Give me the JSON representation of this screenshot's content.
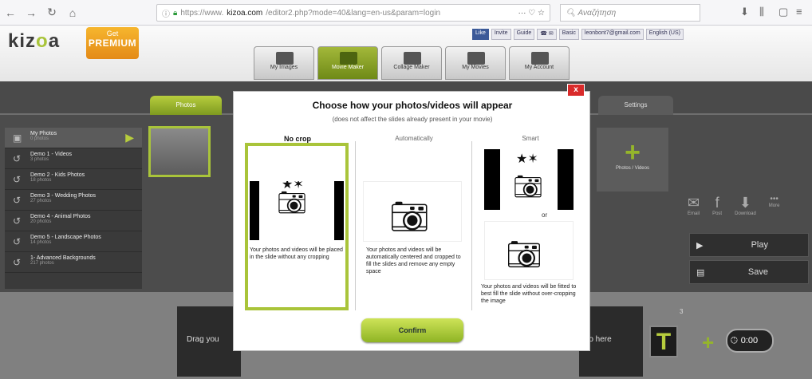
{
  "browser": {
    "url_prefix": "https://www.",
    "url_domain": "kizoa.com",
    "url_path": "/editor2.php?mode=40&lang=en-us&param=login",
    "search_placeholder": "Αναζήτηση"
  },
  "header": {
    "logo_a": "kiz",
    "logo_b": "o",
    "logo_c": "a",
    "premium_get": "Get",
    "premium_label": "PREMIUM",
    "fb_like": "Like",
    "invite": "Invite",
    "guide": "Guide",
    "basic": "Basic",
    "email": "leonbont7@gmail.com",
    "language": "English (US)"
  },
  "menu": [
    "My Images",
    "Movie Maker",
    "Collage Maker",
    "My Movies",
    "My Account"
  ],
  "tabs": {
    "photos": "Photos",
    "settings": "Settings"
  },
  "albums": [
    {
      "name": "My Photos",
      "count": "0 photos"
    },
    {
      "name": "Demo 1 - Videos",
      "count": "3 photos"
    },
    {
      "name": "Demo 2 - Kids Photos",
      "count": "18 photos"
    },
    {
      "name": "Demo 3 - Wedding Photos",
      "count": "27 photos"
    },
    {
      "name": "Demo 4 - Animal Photos",
      "count": "20 photos"
    },
    {
      "name": "Demo 5 - Landscape Photos",
      "count": "14 photos"
    },
    {
      "name": "1- Advanced Backgrounds",
      "count": "217 photos"
    }
  ],
  "right_panel": {
    "add_label": "Photos / Videos",
    "email": "Email",
    "post": "Post",
    "download": "Download",
    "more": "More",
    "play": "Play",
    "save": "Save"
  },
  "timeline": {
    "drag_text": "Drag you",
    "photo_text": "oto here",
    "slide_number": "3",
    "duration": "0:00"
  },
  "modal": {
    "title": "Choose how your photos/videos will appear",
    "subtitle": "(does not affect the slides already present in your movie)",
    "close": "x",
    "options": [
      {
        "label": "No crop",
        "desc": "Your photos and videos will be placed in the slide without any cropping"
      },
      {
        "label": "Automatically",
        "desc": "Your photos and videos will be automatically centered and cropped to fill the slides and remove any empty space"
      },
      {
        "label": "Smart",
        "desc": "Your photos and videos will be fitted to best fill the slide without over-cropping the image"
      }
    ],
    "or": "or",
    "confirm": "Confirm"
  },
  "colors": {
    "accent": "#a9c43a",
    "close_red": "#d92a2a"
  }
}
